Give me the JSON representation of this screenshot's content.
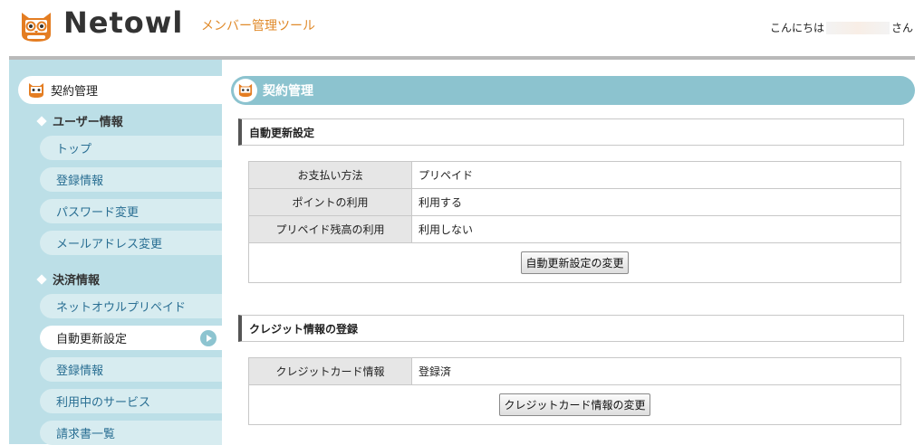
{
  "header": {
    "logo_text": "Netowl",
    "tool_title": "メンバー管理ツール",
    "greeting_prefix": "こんにちは",
    "greeting_suffix": "さん"
  },
  "sidebar": {
    "main_item": "契約管理",
    "sections": [
      {
        "title": "ユーザー情報",
        "items": [
          "トップ",
          "登録情報",
          "パスワード変更",
          "メールアドレス変更"
        ]
      },
      {
        "title": "決済情報",
        "items": [
          "ネットオウルプリペイド",
          "自動更新設定",
          "登録情報",
          "利用中のサービス",
          "請求書一覧"
        ]
      }
    ],
    "active_item": "自動更新設定"
  },
  "main": {
    "page_title": "契約管理",
    "auto_renew": {
      "heading": "自動更新設定",
      "rows": [
        {
          "label": "お支払い方法",
          "value": "プリペイド"
        },
        {
          "label": "ポイントの利用",
          "value": "利用する"
        },
        {
          "label": "プリペイド残高の利用",
          "value": "利用しない"
        }
      ],
      "button": "自動更新設定の変更"
    },
    "credit": {
      "heading": "クレジット情報の登録",
      "rows": [
        {
          "label": "クレジットカード情報",
          "value": "登録済"
        }
      ],
      "button": "クレジットカード情報の変更"
    }
  },
  "colors": {
    "accent_orange": "#e08a2a",
    "sidebar_bg": "#bcdfe7",
    "banner_bg": "#8cc3cf",
    "link_blue": "#2a6f93"
  }
}
